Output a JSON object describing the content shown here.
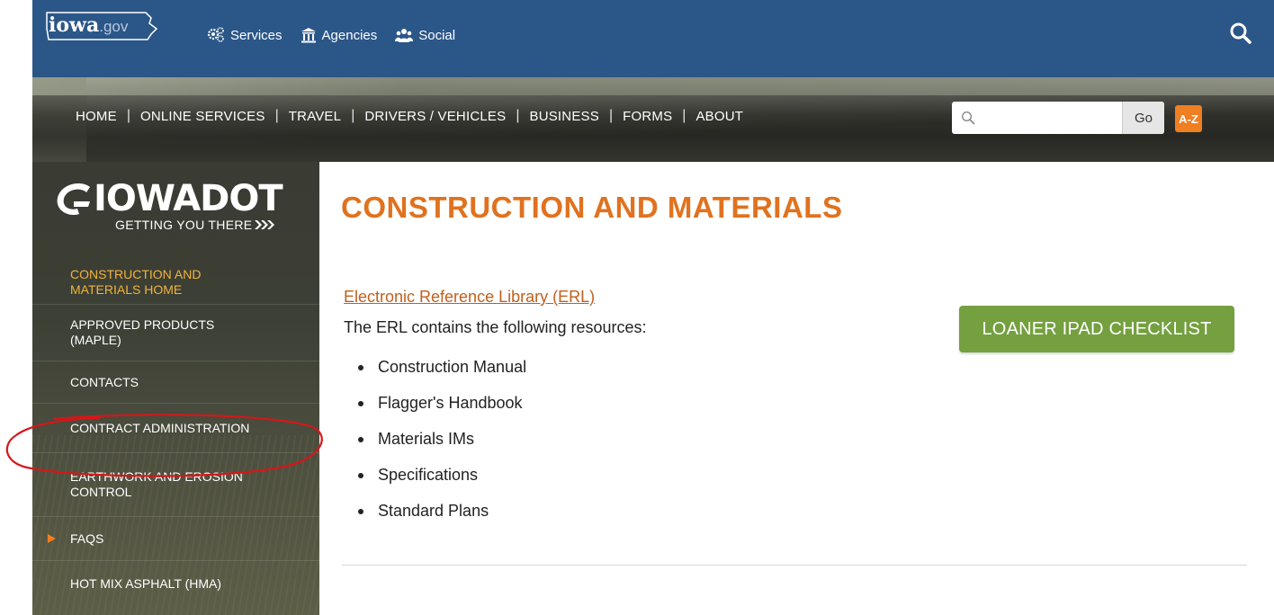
{
  "top_bar": {
    "logo_text": "iowa",
    "logo_suffix": ".gov",
    "nav": [
      {
        "label": "Services",
        "icon": "gears-icon"
      },
      {
        "label": "Agencies",
        "icon": "building-icon"
      },
      {
        "label": "Social",
        "icon": "people-icon"
      }
    ],
    "search_icon": "search-icon",
    "bar_color": "#2b5688"
  },
  "main_nav": {
    "items": [
      "HOME",
      "ONLINE SERVICES",
      "TRAVEL",
      "DRIVERS / VEHICLES",
      "BUSINESS",
      "FORMS",
      "ABOUT"
    ],
    "search": {
      "placeholder": "",
      "value": "",
      "go_label": "Go"
    },
    "az_label": "A-Z"
  },
  "brand": {
    "name": "IOWADOT",
    "tagline": "GETTING YOU THERE"
  },
  "sidebar": {
    "items": [
      {
        "label": "CONSTRUCTION AND MATERIALS HOME",
        "active": true
      },
      {
        "label": "APPROVED PRODUCTS (MAPLE)"
      },
      {
        "label": "CONTACTS"
      },
      {
        "label": "CONTRACT ADMINISTRATION",
        "annotated": true
      },
      {
        "label": "EARTHWORK AND EROSION CONTROL"
      },
      {
        "label": "FAQS",
        "has_arrow": true
      },
      {
        "label": "HOT MIX ASPHALT (HMA)"
      }
    ],
    "active_color": "#f2b33c",
    "annotation_color": "#d4171a"
  },
  "main": {
    "title": "CONSTRUCTION AND MATERIALS",
    "title_color": "#e0721f",
    "erl_link": "Electronic Reference Library (ERL)",
    "erl_description": "The ERL contains the following resources:",
    "resources": [
      "Construction Manual",
      "Flagger's Handbook",
      "Materials IMs",
      "Specifications",
      "Standard Plans"
    ],
    "loaner_button": "LOANER IPAD CHECKLIST",
    "loaner_color": "#74a03f"
  }
}
